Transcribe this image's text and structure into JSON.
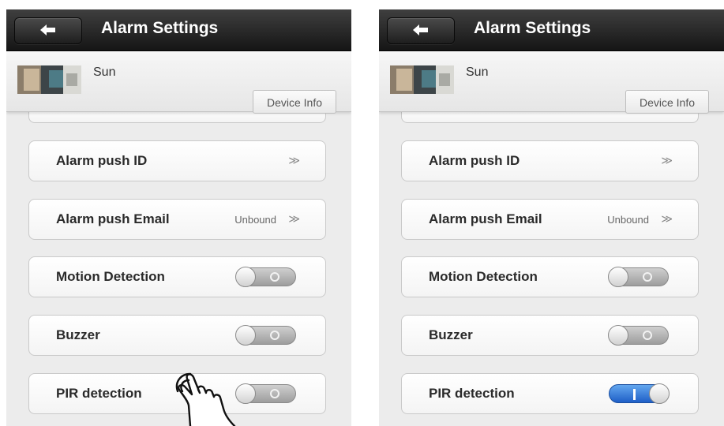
{
  "title": "Alarm Settings",
  "device": {
    "name": "Sun",
    "info_button": "Device Info"
  },
  "rows": {
    "push_id": {
      "label": "Alarm push ID",
      "arrow": "≫"
    },
    "push_email": {
      "label": "Alarm push Email",
      "value": "Unbound",
      "arrow": "≫"
    },
    "motion": {
      "label": "Motion Detection"
    },
    "buzzer": {
      "label": "Buzzer"
    },
    "pir": {
      "label": "PIR detection"
    }
  },
  "states": {
    "before": {
      "motion_detection": "off",
      "buzzer": "off",
      "pir_detection": "off"
    },
    "after": {
      "motion_detection": "off",
      "buzzer": "off",
      "pir_detection": "on"
    }
  },
  "icons": {
    "back": "back-arrow-icon",
    "cursor": "hand-pointer-icon"
  },
  "colors": {
    "titlebar": "#1f1f1f",
    "background": "#ececec",
    "toggle_off": "#b5b5b5",
    "toggle_on": "#2e6fd6"
  }
}
